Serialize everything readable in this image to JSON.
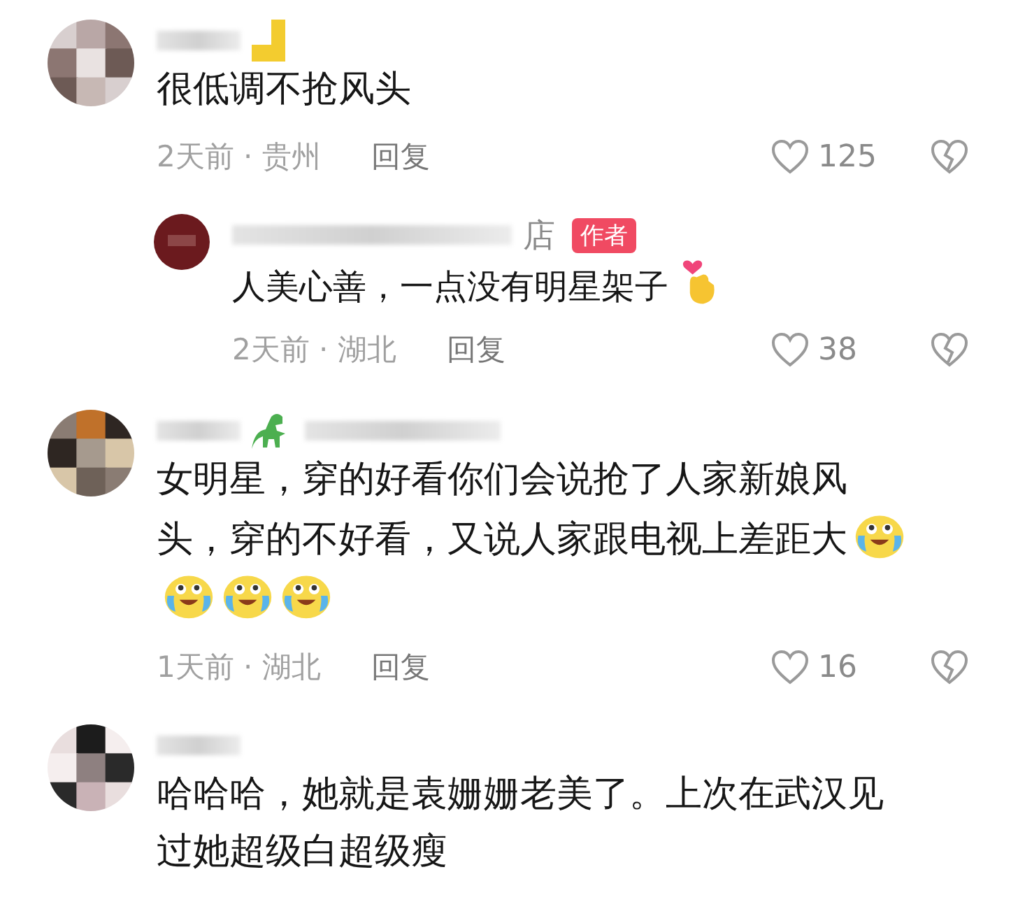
{
  "comments": [
    {
      "avatar": {
        "kind": "picture"
      },
      "sticker": true,
      "text": "很低调不抢风头",
      "meta": "2天前 · 贵州",
      "reply_label": "回复",
      "likes": "125",
      "replies": [
        {
          "avatar": {
            "kind": "picture"
          },
          "name_tail": "店",
          "badge": "作者",
          "text": "人美心善，一点没有明星架子",
          "emojis": [
            {
              "kind": "finger-heart"
            }
          ],
          "meta": "2天前 · 湖北",
          "reply_label": "回复",
          "likes": "38"
        }
      ]
    },
    {
      "avatar": {
        "kind": "picture"
      },
      "dino": true,
      "text_lines": [
        "女明星，穿的好看你们会说抢了人家新娘风",
        "头，穿的不好看，又说人家跟电视上差距大"
      ],
      "emojis": [
        {
          "kind": "cry-laugh"
        },
        {
          "kind": "cry-laugh"
        },
        {
          "kind": "cry-laugh"
        },
        {
          "kind": "cry-laugh"
        }
      ],
      "meta": "1天前 · 湖北",
      "reply_label": "回复",
      "likes": "16"
    },
    {
      "avatar": {
        "kind": "picture"
      },
      "text_lines": [
        "哈哈哈，她就是袁姗姗老美了。上次在武汉见",
        "过她超级白超级瘦"
      ]
    }
  ]
}
